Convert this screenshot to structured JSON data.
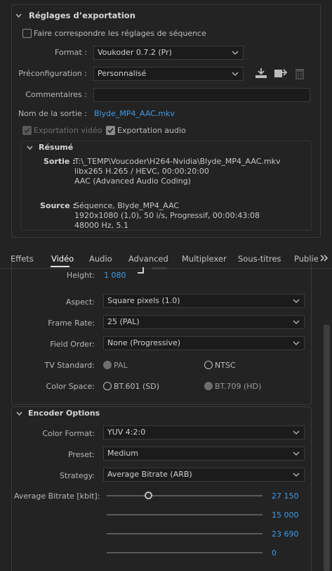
{
  "export_settings": {
    "title": "Réglages d’exportation",
    "match_sequence_label": "Faire correspondre les réglages de séquence",
    "format_label": "Format :",
    "format_value": "Voukoder 0.7.2 (Pr)",
    "preset_label": "Préconfiguration :",
    "preset_value": "Personnalisé",
    "comments_label": "Commentaires :",
    "comments_value": "",
    "output_name_label": "Nom de la sortie :",
    "output_name_value": "Blyde_MP4_AAC.mkv",
    "export_video_label": "Exportation vidéo",
    "export_audio_label": "Exportation audio",
    "summary": {
      "title": "Résumé",
      "output_label": "Sortie :",
      "output_lines": [
        "T:\\_TEMP\\Voucoder\\H264-Nvidia\\Blyde_MP4_AAC.mkv",
        "libx265 H.265 / HEVC, 00:00:20:00",
        "AAC (Advanced Audio Coding)"
      ],
      "source_label": "Source :",
      "source_lines": [
        "Séquence, Blyde_MP4_AAC",
        "1920x1080 (1,0), 50  i/s, Progressif, 00:00:43:08",
        "48000 Hz, 5.1"
      ]
    }
  },
  "tabs": [
    {
      "label": "Effets"
    },
    {
      "label": "Vidéo"
    },
    {
      "label": "Audio"
    },
    {
      "label": "Advanced"
    },
    {
      "label": "Multiplexer"
    },
    {
      "label": "Sous-titres"
    },
    {
      "label": "Publier"
    }
  ],
  "video": {
    "height_label": "Height:",
    "height_value": "1 080",
    "aspect_label": "Aspect:",
    "aspect_value": "Square pixels (1.0)",
    "frame_rate_label": "Frame Rate:",
    "frame_rate_value": "25 (PAL)",
    "field_order_label": "Field Order:",
    "field_order_value": "None (Progressive)",
    "tv_standard_label": "TV Standard:",
    "tv_pal": "PAL",
    "tv_ntsc": "NTSC",
    "color_space_label": "Color Space:",
    "cs_601": "BT.601 (SD)",
    "cs_709": "BT.709 (HD)"
  },
  "encoder": {
    "title": "Encoder Options",
    "color_format_label": "Color Format:",
    "color_format_value": "YUV 4:2:0",
    "preset_label": "Preset:",
    "preset_value": "Medium",
    "strategy_label": "Strategy:",
    "strategy_value": "Average Bitrate (ARB)",
    "avg_bitrate_label": "Average Bitrate [kbit]:",
    "slider_values": [
      "27 150",
      "15 000",
      "23 690",
      "0"
    ]
  },
  "colors": {
    "accent": "#3d9be9",
    "background": "#232323"
  }
}
